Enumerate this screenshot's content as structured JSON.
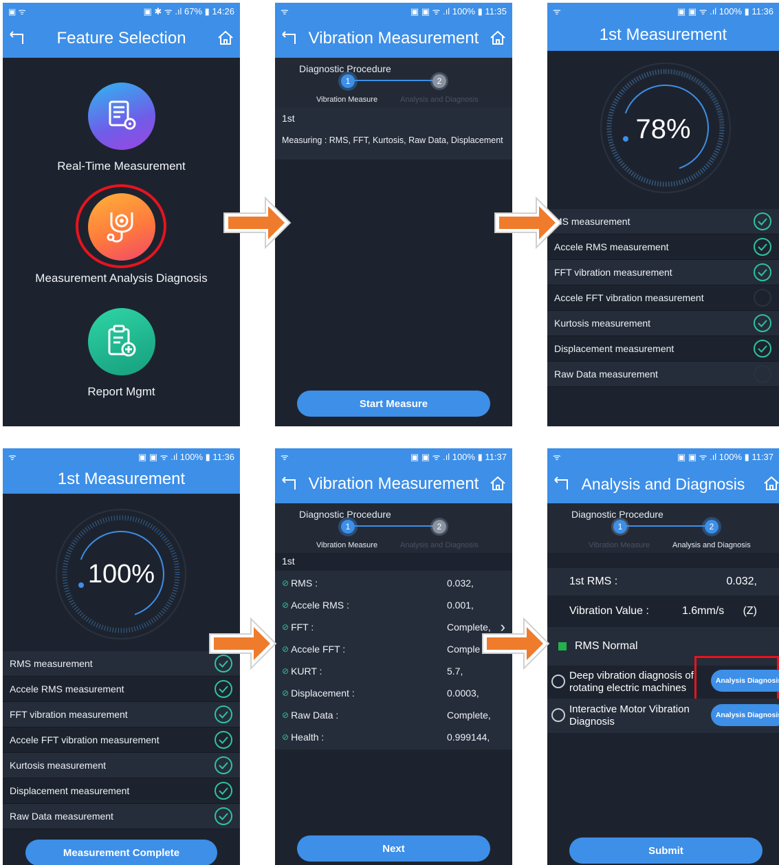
{
  "screen1": {
    "status_left": "▣ ᯤ",
    "status_right": "▣ ✱ ᯤ .ıl 67% ▮ 14:26",
    "title": "Feature Selection",
    "features": [
      {
        "label": "Real-Time Measurement",
        "icon": "document-gear-icon"
      },
      {
        "label": "Measurement Analysis Diagnosis",
        "icon": "stethoscope-gear-icon"
      },
      {
        "label": "Report Mgmt",
        "icon": "clipboard-plus-icon"
      }
    ]
  },
  "screen2": {
    "status_left": "ᯤ",
    "status_right": "▣ ▣ ᯤ .ıl 100% ▮ 11:35",
    "title": "Vibration Measurement",
    "procedure_title": "Diagnostic Procedure",
    "step1_num": "1",
    "step2_num": "2",
    "step1_label": "Vibration Measure",
    "step2_label": "Analysis and Diagnosis",
    "section": "1st",
    "measuring": "Measuring : RMS, FFT, Kurtosis, Raw Data, Displacement",
    "button": "Start Measure"
  },
  "screen3": {
    "status_left": "ᯤ",
    "status_right": "▣ ▣ ᯤ .ıl 100% ▮ 11:36",
    "title": "1st Measurement",
    "progress_text": "78%",
    "progress": 0.78,
    "items": [
      {
        "label": "MS measurement",
        "done": true
      },
      {
        "label": "Accele RMS measurement",
        "done": true
      },
      {
        "label": "FFT vibration measurement",
        "done": true
      },
      {
        "label": "Accele FFT vibration measurement",
        "done": false
      },
      {
        "label": "Kurtosis measurement",
        "done": true
      },
      {
        "label": "Displacement measurement",
        "done": true
      },
      {
        "label": "Raw Data measurement",
        "done": false
      }
    ]
  },
  "screen4": {
    "status_left": "ᯤ",
    "status_right": "▣ ▣ ᯤ .ıl 100% ▮ 11:36",
    "title": "1st Measurement",
    "progress_text": "100%",
    "progress": 1.0,
    "items": [
      {
        "label": "RMS measurement",
        "done": true
      },
      {
        "label": "Accele RMS measurement",
        "done": true
      },
      {
        "label": "FFT vibration measurement",
        "done": true
      },
      {
        "label": "Accele FFT vibration measurement",
        "done": true
      },
      {
        "label": "Kurtosis measurement",
        "done": true
      },
      {
        "label": "Displacement measurement",
        "done": true
      },
      {
        "label": "Raw Data measurement",
        "done": true
      }
    ],
    "button": "Measurement Complete"
  },
  "screen5": {
    "status_left": "ᯤ",
    "status_right": "▣ ▣ ᯤ .ıl 100% ▮ 11:37",
    "title": "Vibration Measurement",
    "procedure_title": "Diagnostic Procedure",
    "step1_num": "1",
    "step2_num": "2",
    "step1_label": "Vibration Measure",
    "step2_label": "Analysis and Diagnosis",
    "section": "1st",
    "results": [
      {
        "key": "RMS :",
        "value": "0.032,"
      },
      {
        "key": "Accele RMS :",
        "value": "0.001,"
      },
      {
        "key": "FFT :",
        "value": "Complete,"
      },
      {
        "key": "Accele FFT :",
        "value": "Comple"
      },
      {
        "key": "KURT :",
        "value": "5.7,"
      },
      {
        "key": "Displacement :",
        "value": "0.0003,"
      },
      {
        "key": "Raw Data :",
        "value": "Complete,"
      },
      {
        "key": "Health :",
        "value": "0.999144,"
      }
    ],
    "button": "Next"
  },
  "screen6": {
    "status_left": "ᯤ",
    "status_right": "▣ ▣ ᯤ .ıl 100% ▮ 11:37",
    "title": "Analysis and Diagnosis",
    "procedure_title": "Diagnostic Procedure",
    "step1_num": "1",
    "step2_num": "2",
    "step1_label": "Vibration Measure",
    "step2_label": "Analysis and Diagnosis",
    "rms_label": "1st RMS :",
    "rms_value": "0.032,",
    "vib_label": "Vibration Value :",
    "vib_value": "1.6mm/s",
    "vib_axis": "(Z)",
    "status_text": "RMS Normal",
    "status_color": "#22b14c",
    "options": [
      {
        "line1": "Deep vibration diagnosis of",
        "line2": "rotating electric machines",
        "button": "Analysis Diagnosis"
      },
      {
        "line1": "Interactive Motor Vibration",
        "line2": "Diagnosis",
        "button": "Analysis Diagnosis"
      }
    ],
    "button": "Submit"
  },
  "colors": {
    "accent": "#3d8fe8",
    "panel": "#1d232e",
    "check": "#2fc2a0",
    "flow_arrow": "#ee7c2c",
    "highlight": "#e6141e"
  }
}
